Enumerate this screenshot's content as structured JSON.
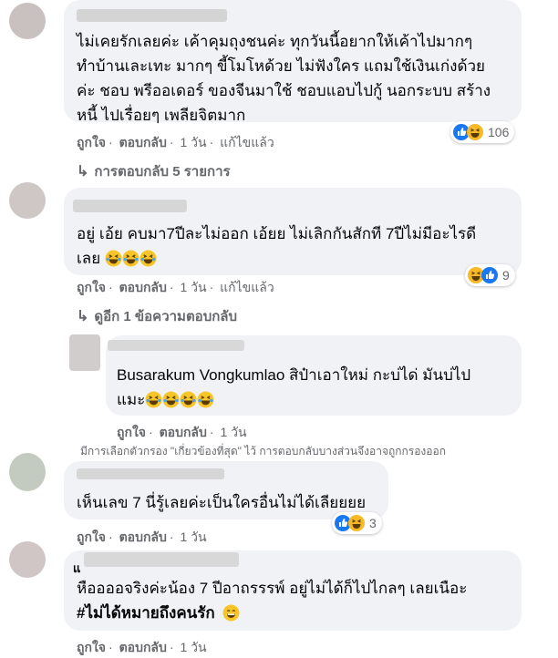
{
  "comments": [
    {
      "text": "ไม่เคยรักเลยค่ะ เค้าคุมถุงชนค่ะ ทุกวันนี้อยากให้เค้าไปมากๆ ทำบ้านเละเทะ มากๆ ขี้โมโหด้วย ไม่ฟังใคร แถมใช้เงินเก่งด้วยค่ะ ชอบ พรีออเดอร์ ของจีนมาใช้ ชอบแอบไปกู้ นอกระบบ สร้างหนี้ ไปเรื่อยๆ เพลียจิตมาก",
      "lines": [
        "ไม่เคยรักเลยค่ะ เค้าคุมถุงชนค่ะ ทุกวันนี้อยากให้เค้าไปมากๆ",
        "ทำบ้านเละเทะ มากๆ ขี้โมโหด้วย ไม่ฟังใคร แถมใช้เงินเก่งด้วย",
        "ค่ะ ชอบ พรีออเดอร์ ของจีนมาใช้ ชอบแอบไปกู้ นอกระบบ สร้าง",
        "หนี้ ไปเรื่อยๆ เพลียจิตมาก"
      ],
      "like": "ถูกใจ",
      "reply": "ตอบกลับ",
      "time": "1 วัน",
      "edited": "แก้ไขแล้ว",
      "reaction_count": "106"
    },
    {
      "lines": [
        "อยู่ เอ้ย คบมา7ปีละไม่ออก เอ้ยย ไม่เลิกกันสักที 7ปีไม่มีอะไรดี",
        "เลย"
      ],
      "like": "ถูกใจ",
      "reply": "ตอบกลับ",
      "time": "1 วัน",
      "edited": "แก้ไขแล้ว",
      "reaction_count": "9"
    },
    {
      "name": "Busarakum Vongkumlao",
      "lines": [
        "สิป๋าเอาใหม่ กะบ่ได่ มันบ่ไป",
        "แมะ"
      ],
      "like": "ถูกใจ",
      "reply": "ตอบกลับ",
      "time": "1 วัน"
    },
    {
      "lines": [
        "เห็นเลข 7 นี่รู้เลยค่ะเป็นใครอื่นไม่ได้เลียยยย"
      ],
      "like": "ถูกใจ",
      "reply": "ตอบกลับ",
      "time": "1 วัน",
      "reaction_count": "3"
    },
    {
      "name_fragment": "แ",
      "lines": [
        "หืออออจริงค่ะน้อง 7 ปีอาถรรรพ์ อยู่ไม่ได้ก็ไปไกลๆ เลยเนือะ",
        "#ไม่ได้หมายถึงคนรัก"
      ],
      "like": "ถูกใจ",
      "reply": "ตอบกลับ",
      "time": "1 วัน"
    }
  ],
  "replies_link_1": "การตอบกลับ 5 รายการ",
  "replies_link_2": "ดูอีก 1 ข้อความตอบกลับ",
  "filter_note": "มีการเลือกตัวกรอง \"เกี่ยวข้องที่สุด\" ไว้ การตอบกลับบางส่วนจึงอาจถูกกรองออก",
  "icons": {
    "like": "like-icon",
    "haha": "haha-icon",
    "reply_arrow": "reply-arrow-icon"
  },
  "colors": {
    "bubble": "#f0f2f5",
    "meta": "#65676b",
    "like_blue": "#1877f2",
    "haha_yellow": "#f7b928"
  }
}
